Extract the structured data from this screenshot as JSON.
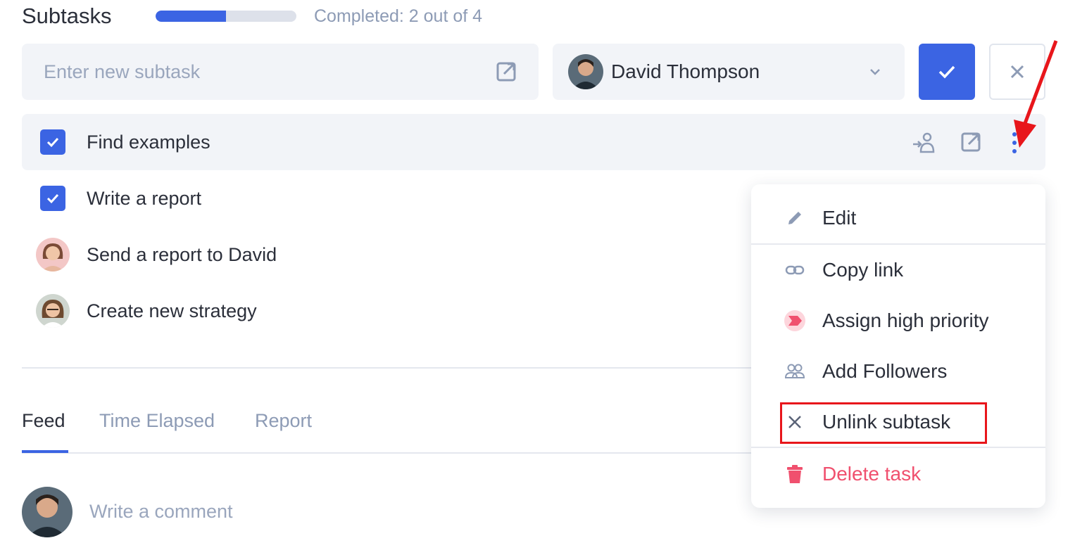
{
  "header": {
    "title": "Subtasks",
    "progress_fraction": 0.5,
    "progress_text": "Completed: 2 out of 4"
  },
  "new_subtask": {
    "placeholder": "Enter new subtask",
    "open_icon": "external-link-icon",
    "assignee_name": "David Thompson",
    "assignee_dropdown_icon": "chevron-down-icon",
    "confirm_icon": "check-icon",
    "cancel_icon": "close-icon"
  },
  "subtasks": [
    {
      "label": "Find examples",
      "status": "checked"
    },
    {
      "label": "Write a report",
      "status": "checked"
    },
    {
      "label": "Send a report to David",
      "status": "avatar"
    },
    {
      "label": "Create new strategy",
      "status": "avatar"
    }
  ],
  "row_actions": {
    "assign_icon": "assign-user-icon",
    "open_icon": "external-link-icon",
    "more_icon": "more-vertical-icon"
  },
  "tabs": [
    {
      "label": "Feed",
      "active": true
    },
    {
      "label": "Time Elapsed",
      "active": false
    },
    {
      "label": "Report",
      "active": false
    }
  ],
  "comment": {
    "placeholder": "Write a comment"
  },
  "context_menu": {
    "items": [
      {
        "label": "Edit",
        "icon": "pencil-icon"
      },
      {
        "label": "Copy link",
        "icon": "link-icon"
      },
      {
        "label": "Assign high priority",
        "icon": "priority-flag-icon"
      },
      {
        "label": "Add Followers",
        "icon": "followers-icon"
      },
      {
        "label": "Unlink subtask",
        "icon": "close-icon"
      },
      {
        "label": "Delete task",
        "icon": "trash-icon"
      }
    ]
  },
  "colors": {
    "accent": "#3b64e3",
    "danger": "#f0506e",
    "annotation": "#e8161b",
    "muted_text": "#8d9bb5"
  }
}
